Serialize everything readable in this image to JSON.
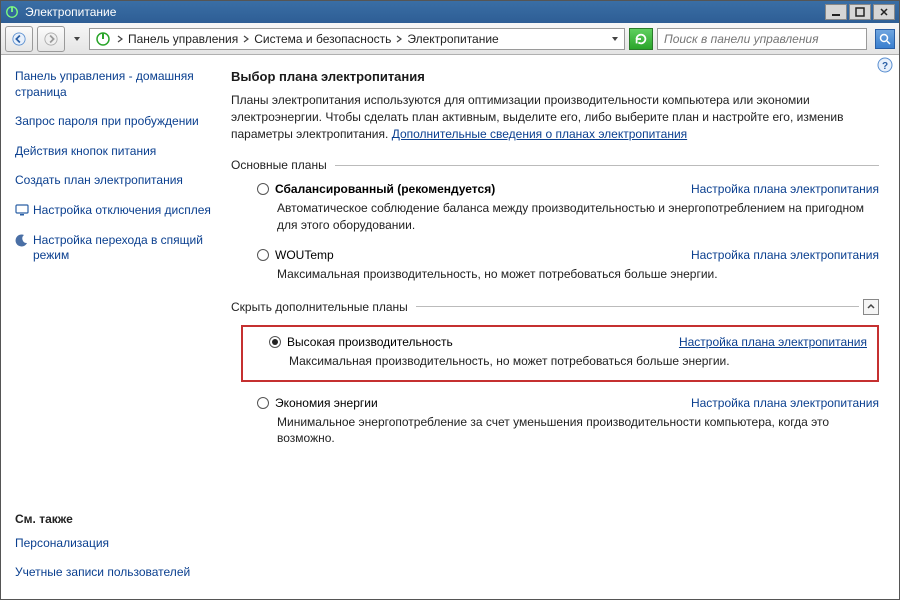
{
  "window": {
    "title": "Электропитание"
  },
  "breadcrumb": {
    "items": [
      "Панель управления",
      "Система и безопасность",
      "Электропитание"
    ]
  },
  "search": {
    "placeholder": "Поиск в панели управления"
  },
  "sidebar": {
    "links": [
      {
        "label": "Панель управления - домашняя страница",
        "icon": null
      },
      {
        "label": "Запрос пароля при пробуждении",
        "icon": null
      },
      {
        "label": "Действия кнопок питания",
        "icon": null
      },
      {
        "label": "Создать план электропитания",
        "icon": null
      },
      {
        "label": "Настройка отключения дисплея",
        "icon": "monitor"
      },
      {
        "label": "Настройка перехода в спящий режим",
        "icon": "moon"
      }
    ],
    "footer": {
      "heading": "См. также",
      "links": [
        "Персонализация",
        "Учетные записи пользователей"
      ]
    }
  },
  "main": {
    "heading": "Выбор плана электропитания",
    "intro": "Планы электропитания используются для оптимизации производительности компьютера или экономии электроэнергии. Чтобы сделать план активным, выделите его, либо выберите план и настройте его, изменив параметры электропитания.",
    "intro_link": "Дополнительные сведения о планах электропитания",
    "group1_label": "Основные планы",
    "group2_label": "Скрыть дополнительные планы",
    "plan_link_text": "Настройка плана электропитания",
    "plans_basic": [
      {
        "name": "Сбалансированный (рекомендуется)",
        "desc": "Автоматическое соблюдение баланса между производительностью и энергопотреблением на пригодном для этого оборудовании.",
        "selected": false,
        "bold": true
      },
      {
        "name": "WOUTemp",
        "desc": "Максимальная производительность, но может потребоваться больше энергии.",
        "selected": false,
        "bold": false
      }
    ],
    "plans_extra": [
      {
        "name": "Высокая производительность",
        "desc": "Максимальная производительность, но может потребоваться больше энергии.",
        "selected": true,
        "bold": false,
        "highlighted": true
      },
      {
        "name": "Экономия энергии",
        "desc": "Минимальное энергопотребление за счет уменьшения производительности компьютера, когда это возможно.",
        "selected": false,
        "bold": false
      }
    ]
  }
}
